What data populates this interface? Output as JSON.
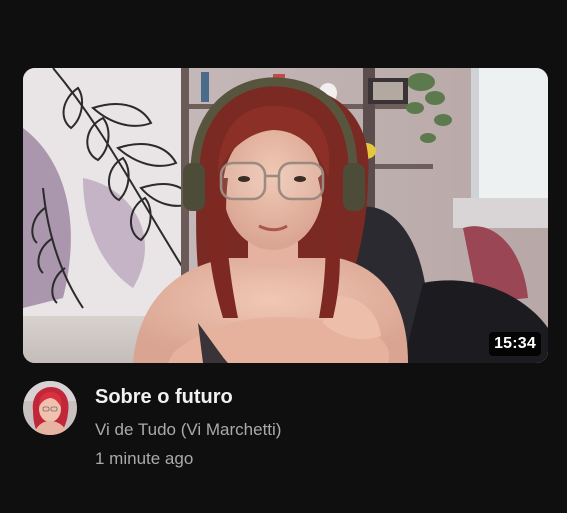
{
  "video": {
    "duration": "15:34",
    "title": "Sobre o futuro",
    "channel": "Vi de Tudo (Vi Marchetti)",
    "age": "1 minute ago"
  },
  "icons": {
    "thumbnail": "video-thumbnail-image",
    "avatar": "channel-avatar-image"
  },
  "colors": {
    "background": "#0f0f0f",
    "title": "#f1f1f1",
    "secondary_text": "#aaaaaa",
    "duration_badge_bg": "#000000"
  }
}
